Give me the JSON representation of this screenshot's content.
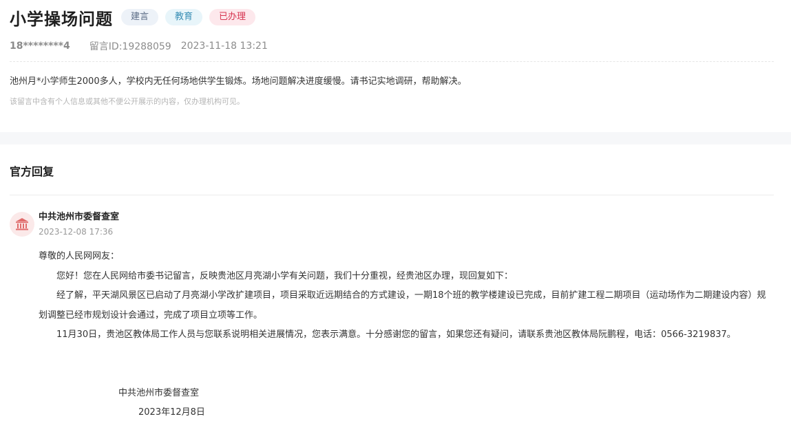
{
  "message": {
    "title": "小学操场问题",
    "tags": {
      "type": "建言",
      "field": "教育",
      "status": "已办理"
    },
    "author": "18********4",
    "id_label": "留言ID:19288059",
    "datetime": "2023-11-18 13:21",
    "body": "池州月*小学师生2000多人，学校内无任何场地供学生锻炼。场地问题解决进度缓慢。请书记实地调研，帮助解决。",
    "privacy_note": "该留言中含有个人信息或其他不便公开展示的内容，仅办理机构可见。"
  },
  "reply": {
    "section_title": "官方回复",
    "org_name": "中共池州市委督查室",
    "time": "2023-12-08 17:36",
    "greeting": "尊敬的人民网网友：",
    "paragraphs": [
      "您好！您在人民网给市委书记留言，反映贵池区月亮湖小学有关问题，我们十分重视，经贵池区办理，现回复如下：",
      "经了解，平天湖风景区已启动了月亮湖小学改扩建项目，项目采取近远期结合的方式建设，一期18个班的教学楼建设已完成，目前扩建工程二期项目（运动场作为二期建设内容）规划调整已经市规划设计会通过，完成了项目立项等工作。",
      "11月30日，贵池区教体局工作人员与您联系说明相关进展情况，您表示满意。十分感谢您的留言，如果您还有疑问，请联系贵池区教体局阮鹏程，电话：0566-3219837。"
    ],
    "signature_org": "中共池州市委督查室",
    "signature_date": "2023年12月8日"
  },
  "colors": {
    "status_red": "#d6334f",
    "field_blue": "#3a8fb5",
    "avatar_red": "#e06b6b"
  },
  "icons": {
    "org_avatar": "government-building-icon"
  }
}
